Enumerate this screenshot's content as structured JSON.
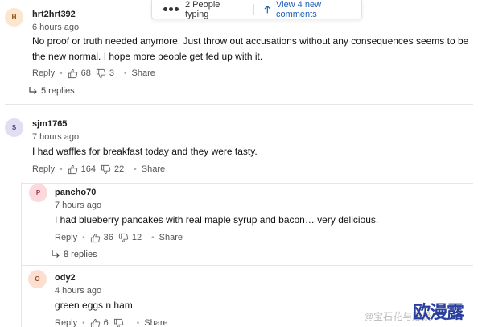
{
  "typing_bar": {
    "typing_text": "2 People typing",
    "view_new_text": "View 4 new comments"
  },
  "actions": {
    "reply": "Reply",
    "share": "Share"
  },
  "comments": [
    {
      "avatar_letter": "H",
      "avatar_bg": "#fde6cf",
      "avatar_fg": "#8a4b10",
      "username": "hrt2hrt392",
      "time": "6 hours ago",
      "text": "No proof or truth needed anymore.  Just throw out accusations without any consequences seems to be the new normal.  I hope more people get fed up with it.",
      "likes": "68",
      "dislikes": "3",
      "replies": "5 replies"
    },
    {
      "avatar_letter": "S",
      "avatar_bg": "#e3ddf3",
      "avatar_fg": "#4a3a7a",
      "username": "sjm1765",
      "time": "7 hours ago",
      "text": "I had waffles for breakfast today and they were tasty.",
      "likes": "164",
      "dislikes": "22"
    },
    {
      "avatar_letter": "P",
      "avatar_bg": "#fbd9dc",
      "avatar_fg": "#a23a44",
      "username": "pancho70",
      "time": "7 hours ago",
      "text": "I had blueberry pancakes with real maple syrup and bacon… very delicious.",
      "likes": "36",
      "dislikes": "12",
      "replies": "8 replies"
    },
    {
      "avatar_letter": "O",
      "avatar_bg": "#fbe0d2",
      "avatar_fg": "#9a4a22",
      "username": "ody2",
      "time": "4 hours ago",
      "text": "green eggs n ham",
      "likes": "6",
      "dislikes": ""
    }
  ],
  "watermark": {
    "small": "@宝石花与愿景",
    "big": "欧漫露"
  }
}
